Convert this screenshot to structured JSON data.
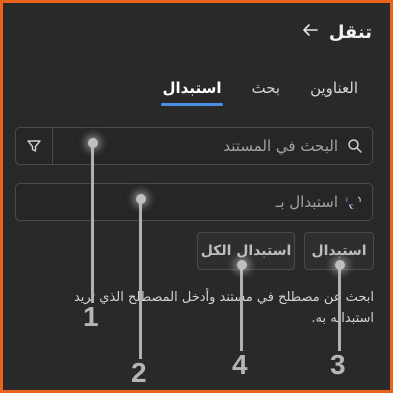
{
  "header": {
    "title": "تنقل",
    "back_icon": "arrow-left-icon"
  },
  "tabs": [
    {
      "label": "العناوين"
    },
    {
      "label": "بحث"
    },
    {
      "label": "استبدال",
      "active": true
    }
  ],
  "search": {
    "placeholder": "البحث في المستند",
    "icon": "search-icon",
    "filter_icon": "filter-icon"
  },
  "replace": {
    "placeholder": "استبدال بـ",
    "icon": "replace-icon"
  },
  "buttons": {
    "replace_label": "استبدال",
    "replace_all_label": "استبدال الكل"
  },
  "description": "ابحث عن مصطلح في مستند وأدخل المصطلح الذي تريد استبداله به.",
  "callouts": {
    "one": "1",
    "two": "2",
    "three": "3",
    "four": "4"
  },
  "colors": {
    "background": "#292929",
    "border": "#e8641a",
    "accent": "#4a90e2"
  }
}
